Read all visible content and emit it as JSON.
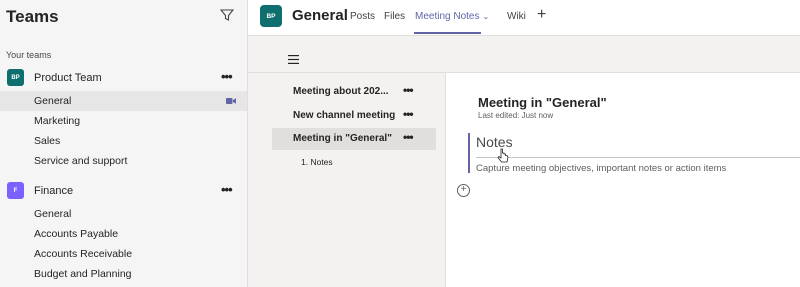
{
  "left_pane": {
    "title": "Teams",
    "section_label": "Your teams",
    "teams": [
      {
        "avatar": "BP",
        "avatar_color": "#0f6e6e",
        "name": "Product Team",
        "more": "•••",
        "channels": [
          "General",
          "Marketing",
          "Sales",
          "Service and support"
        ]
      },
      {
        "avatar": "F",
        "avatar_color": "#7b61ff",
        "name": "Finance",
        "more": "•••",
        "channels": [
          "General",
          "Accounts Payable",
          "Accounts Receivable",
          "Budget and Planning"
        ]
      }
    ],
    "active_channel": "Product Team / General",
    "filter_icon": "filter-icon",
    "meeting_icon": "video-camera-icon"
  },
  "header": {
    "avatar": "BP",
    "channel_name": "General",
    "tabs": [
      "Posts",
      "Files",
      "Meeting Notes",
      "Wiki"
    ],
    "active_tab": "Meeting Notes",
    "add_tab": "+"
  },
  "notes": {
    "pages": [
      {
        "title": "Meeting about 202...",
        "more": "•••"
      },
      {
        "title": "New channel meeting",
        "more": "•••"
      },
      {
        "title": "Meeting in \"General\"",
        "more": "•••"
      }
    ],
    "sub_item": "1. Notes",
    "page_title": "Meeting in \"General\"",
    "last_edited": "Last edited: Just now",
    "section_heading": "Notes",
    "section_placeholder": "Capture meeting objectives, important notes or action items",
    "add_icon": "⊕"
  },
  "colors": {
    "accent": "#6264a7",
    "left_bg": "#f5f5f5",
    "product_team": "#0f6e6e",
    "finance": "#7b61ff"
  }
}
